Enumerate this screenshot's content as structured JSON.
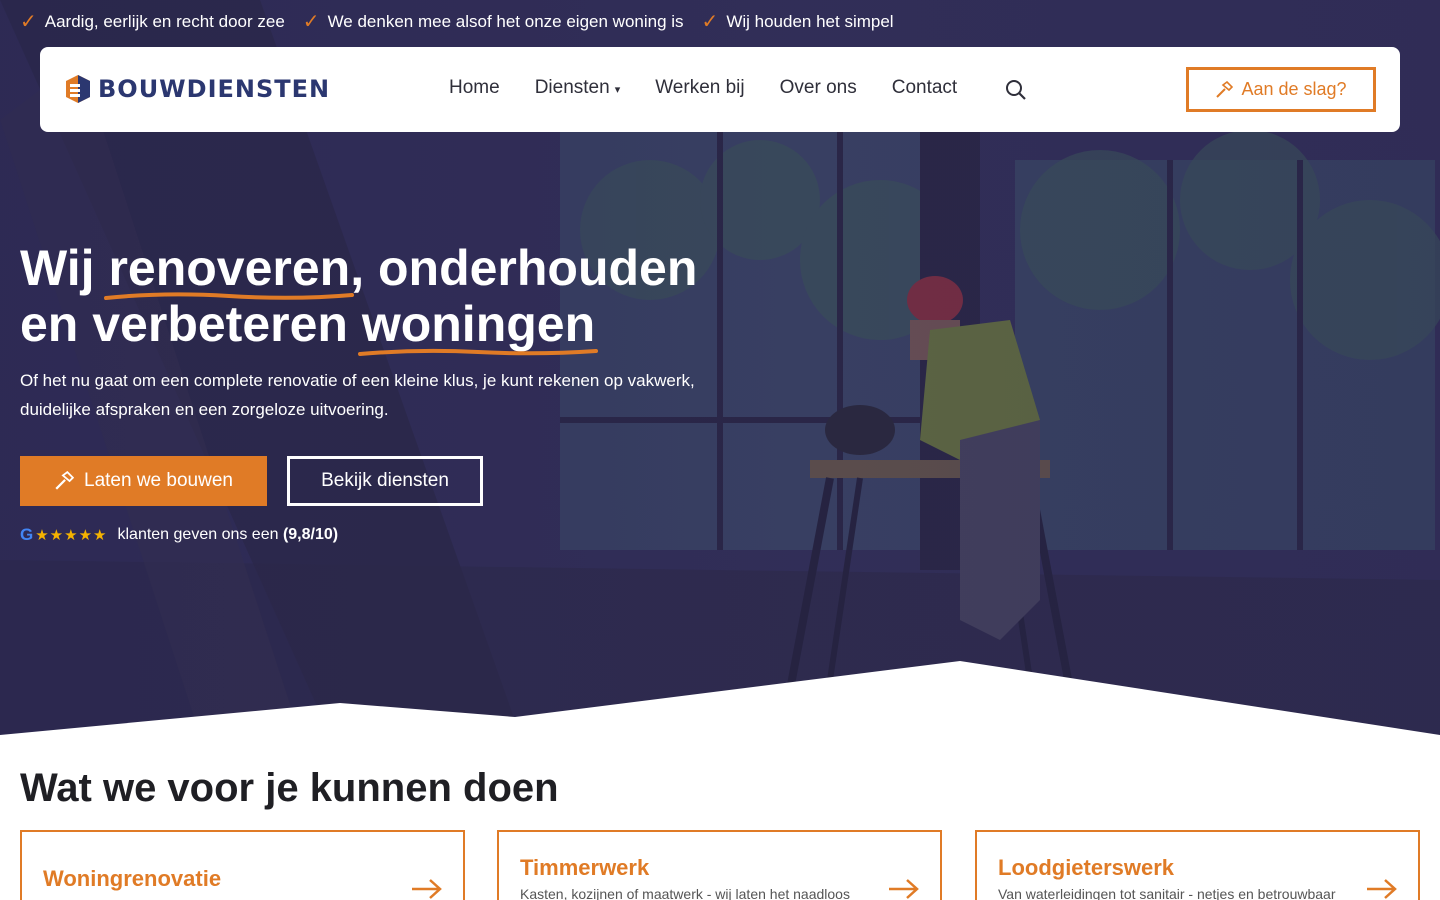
{
  "topbar": {
    "usps": [
      "Aardig, eerlijk en recht door zee",
      "We denken mee alsof het onze eigen woning is",
      "Wij houden het simpel"
    ]
  },
  "logo": {
    "text": "BOUWDIENSTEN"
  },
  "nav": {
    "items": [
      {
        "label": "Home"
      },
      {
        "label": "Diensten"
      },
      {
        "label": "Werken bij"
      },
      {
        "label": "Over ons"
      },
      {
        "label": "Contact"
      }
    ],
    "cta_label": "Aan de slag?"
  },
  "hero": {
    "title_parts": {
      "p1": "Wij ",
      "u1": "renoveren",
      "p2": ", onderhouden",
      "p3": "en verbeteren ",
      "u2": "woningen"
    },
    "subtitle": "Of het nu gaat om een complete renovatie of een kleine klus, je kunt rekenen op vakwerk, duidelijke afspraken en een zorgeloze uitvoering.",
    "primary_button": "Laten we bouwen",
    "secondary_button": "Bekijk diensten",
    "rating": {
      "google_letter": "G",
      "stars": "★★★★★",
      "text": "klanten geven ons een",
      "score": "(9,8/10)"
    }
  },
  "services": {
    "title": "Wat we voor je kunnen doen",
    "cards": [
      {
        "title": "Woningrenovatie",
        "desc": ""
      },
      {
        "title": "Timmerwerk",
        "desc": "Kasten, kozijnen of maatwerk - wij laten het naadloos"
      },
      {
        "title": "Loodgieterswerk",
        "desc": "Van waterleidingen tot sanitair - netjes en betrouwbaar"
      }
    ]
  },
  "colors": {
    "accent": "#e07b26",
    "brand_navy": "#2b3770",
    "hero_overlay": "#35335a"
  }
}
